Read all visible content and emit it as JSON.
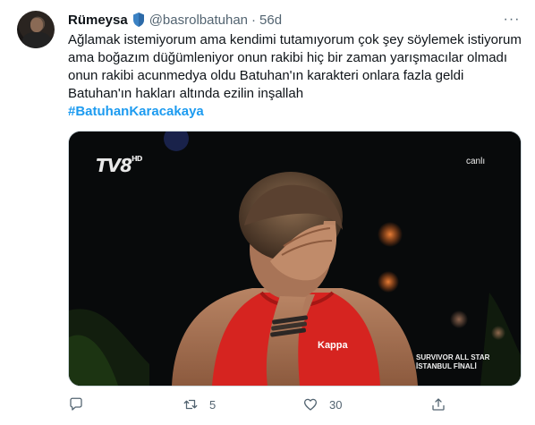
{
  "author": {
    "name": "Rümeysa",
    "handle": "@basrolbatuhan",
    "separator": "·",
    "time": "56d",
    "verified_badge": "shield-badge-icon"
  },
  "menu": {
    "more_label": "···"
  },
  "tweet": {
    "lines": [
      "Ağlamak istemiyorum ama kendimi tutamıyorum çok şey söylemek istiyorum",
      "ama boğazım düğümleniyor onun rakibi hiç bir zaman yarışmacılar olmadı",
      "onun rakibi acunmedya oldu Batuhan'ın karakteri onlara fazla geldi",
      "Batuhan'ın hakları altında ezilin inşallah"
    ],
    "hashtag": "#BatuhanKaracakaya"
  },
  "media": {
    "channel_logo": "TV8",
    "channel_logo_suffix": "HD",
    "live_label": "canlı",
    "caption_line1": "SURVIVOR ALL STAR",
    "caption_line2": "İSTANBUL FİNALİ",
    "shirt_brand": "Kappa"
  },
  "actions": {
    "reply_icon": "comment-icon",
    "retweet_icon": "retweet-icon",
    "retweet_count": "5",
    "like_icon": "heart-icon",
    "like_count": "30",
    "share_icon": "share-icon"
  },
  "colors": {
    "accent": "#1d9bf0",
    "muted": "#536471",
    "text": "#0f1419"
  }
}
